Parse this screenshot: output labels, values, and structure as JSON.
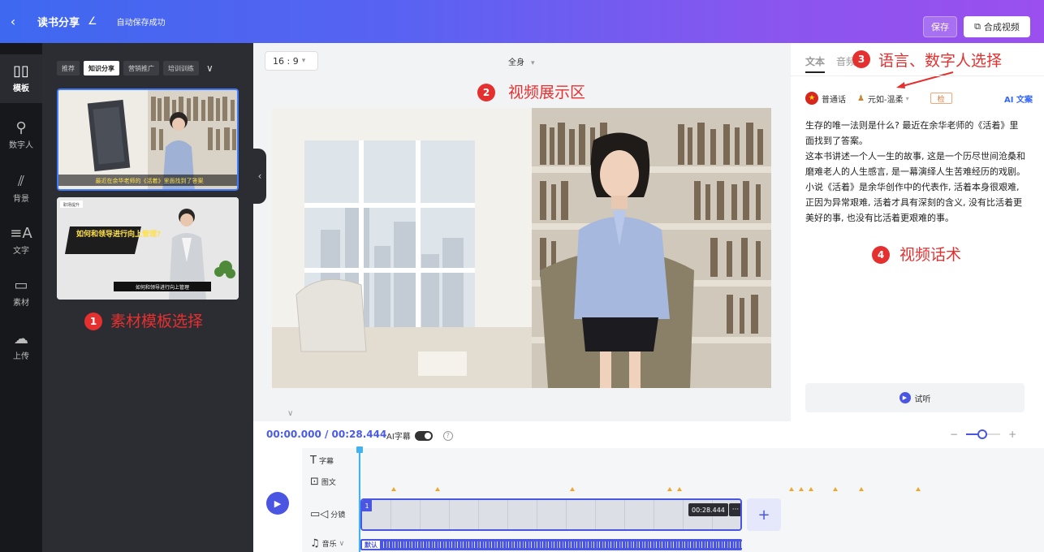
{
  "topbar": {
    "back_icon": "‹",
    "title": "读书分享",
    "edit_icon": "∠",
    "autosave": "自动保存成功",
    "save_label": "保存",
    "compose_label": "合成视频",
    "compose_icon": "⧉"
  },
  "rail": {
    "items": [
      {
        "label": "模板",
        "icon": "▯▯"
      },
      {
        "label": "数字人",
        "icon": "⚲"
      },
      {
        "label": "背景",
        "icon": "⫽"
      },
      {
        "label": "文字",
        "icon": "≡A"
      },
      {
        "label": "素材",
        "icon": "▭"
      },
      {
        "label": "上传",
        "icon": "☁"
      }
    ]
  },
  "material_panel": {
    "tabs": [
      "推荐",
      "知识分享",
      "营销推广",
      "培训训练"
    ],
    "active_tab": "知识分享",
    "more_icon": "∨",
    "templates": [
      {
        "caption": "最近在余华老师的《活着》里面找到了答案"
      },
      {
        "badge": "职场提升",
        "headline": "如何和领导进行向上管理?",
        "caption": "如何和领导进行向上管理"
      }
    ]
  },
  "annotations": {
    "a1": {
      "num": "1",
      "text": "素材模板选择"
    },
    "a2": {
      "num": "2",
      "text": "视频展示区"
    },
    "a3": {
      "num": "3",
      "text": "语言、数字人选择"
    },
    "a4": {
      "num": "4",
      "text": "视频话术"
    }
  },
  "center": {
    "ratio": "16 : 9",
    "ratio_caret": "▾",
    "framing": "全身",
    "framing_caret": "▾",
    "collapse_icon": "‹",
    "expand_icon": "∨"
  },
  "right": {
    "tabs": [
      "文本",
      "音频"
    ],
    "active_tab": "文本",
    "language": "普通话",
    "avatar_name": "元如-温柔",
    "avatar_caret": "▾",
    "check_label": "检",
    "ai_copy": "AI 文案",
    "script": [
      "生存的唯一法则是什么? 最近在余华老师的《活着》里面找到了答案。",
      "这本书讲述一个人一生的故事, 这是一个历尽世间沧桑和磨难老人的人生感言, 是一幕演绎人生苦难经历的戏剧。",
      "小说《活着》是余华创作中的代表作, 活着本身很艰难, 正因为异常艰难, 活着才具有深刻的含义, 没有比活着更美好的事, 也没有比活着更艰难的事。"
    ],
    "listen_label": "试听"
  },
  "timeline": {
    "timecode": "00:00.000 / 00:28.444",
    "ai_subtitle": "AI字幕",
    "help_icon": "?",
    "zoom_minus": "−",
    "zoom_plus": "+",
    "tracks": [
      {
        "label": "字幕",
        "icon": "T"
      },
      {
        "label": "图文",
        "icon": "⊡"
      },
      {
        "label": "分镜",
        "icon": "▭◁"
      },
      {
        "label": "音乐",
        "icon": "♫",
        "caret": "∨"
      }
    ],
    "clip": {
      "index": "1",
      "duration": "00:28.444",
      "more": "···"
    },
    "add_icon": "+",
    "music_default": "默认",
    "play_icon": "▶"
  },
  "colors": {
    "accent": "#4a56e2",
    "annotation": "#e53030",
    "topbar_start": "#3e68f0",
    "topbar_end": "#9a4fee"
  }
}
